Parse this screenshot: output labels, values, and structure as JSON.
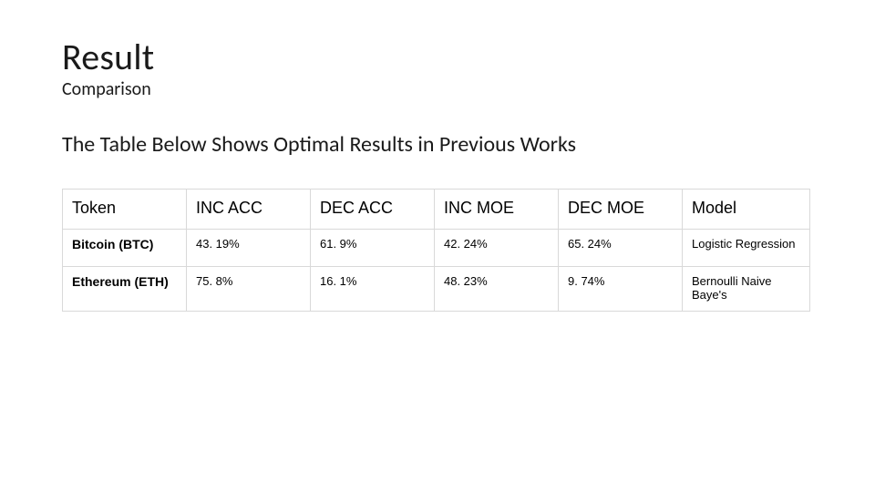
{
  "heading": {
    "title": "Result",
    "subtitle": "Comparison",
    "table_caption": "The Table Below Shows Optimal Results in Previous Works"
  },
  "table": {
    "headers": [
      "Token",
      "INC ACC",
      "DEC ACC",
      "INC MOE",
      "DEC MOE",
      "Model"
    ],
    "rows": [
      {
        "token": "Bitcoin (BTC)",
        "inc_acc": "43. 19%",
        "dec_acc": "61. 9%",
        "inc_moe": "42. 24%",
        "dec_moe": "65. 24%",
        "model": "Logistic Regression"
      },
      {
        "token": "Ethereum (ETH)",
        "inc_acc": "75. 8%",
        "dec_acc": "16. 1%",
        "inc_moe": "48. 23%",
        "dec_moe": "9. 74%",
        "model": "Bernoulli Naive Baye's"
      }
    ]
  },
  "chart_data": {
    "type": "table",
    "title": "Optimal Results in Previous Works",
    "columns": [
      "Token",
      "INC ACC",
      "DEC ACC",
      "INC MOE",
      "DEC MOE",
      "Model"
    ],
    "data": [
      [
        "Bitcoin (BTC)",
        "43.19%",
        "61.9%",
        "42.24%",
        "65.24%",
        "Logistic Regression"
      ],
      [
        "Ethereum (ETH)",
        "75.8%",
        "16.1%",
        "48.23%",
        "9.74%",
        "Bernoulli Naive Baye's"
      ]
    ]
  }
}
